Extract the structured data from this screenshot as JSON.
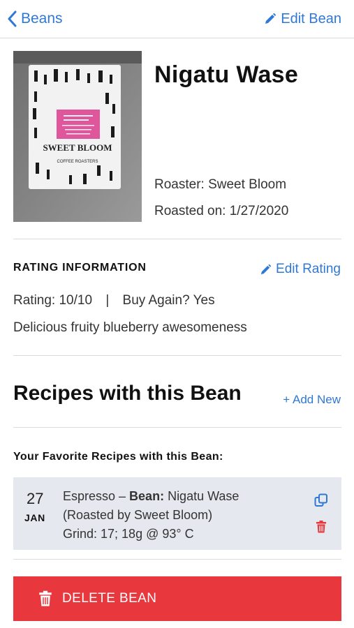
{
  "nav": {
    "back_label": "Beans",
    "edit_label": "Edit Bean"
  },
  "bean": {
    "name": "Nigatu Wase",
    "roaster": "Roaster: Sweet Bloom",
    "roasted_on": "Roasted on: 1/27/2020",
    "bag_brand": "SWEET BLOOM",
    "bag_sub": "COFFEE ROASTERS"
  },
  "rating": {
    "section_title": "RATING INFORMATION",
    "edit_label": "Edit Rating",
    "rating_text": "Rating: 10/10",
    "separator": "|",
    "buy_again": "Buy Again? Yes",
    "notes": "Delicious fruity blueberry awesomeness"
  },
  "recipes": {
    "title": "Recipes with this Bean",
    "add_new": "+ Add New",
    "favorites_title": "Your Favorite Recipes with this Bean:",
    "items": [
      {
        "day": "27",
        "month": "JAN",
        "method": "Espresso – ",
        "bean_label": "Bean:",
        "bean_value": " Nigatu Wase",
        "roasted_by": "(Roasted by Sweet Bloom)",
        "grind": "Grind: 17; 18g @ 93° C"
      }
    ]
  },
  "delete_label": "DELETE BEAN",
  "colors": {
    "accent": "#2f78d6",
    "danger": "#e8373d",
    "card": "#e5e8ee"
  }
}
